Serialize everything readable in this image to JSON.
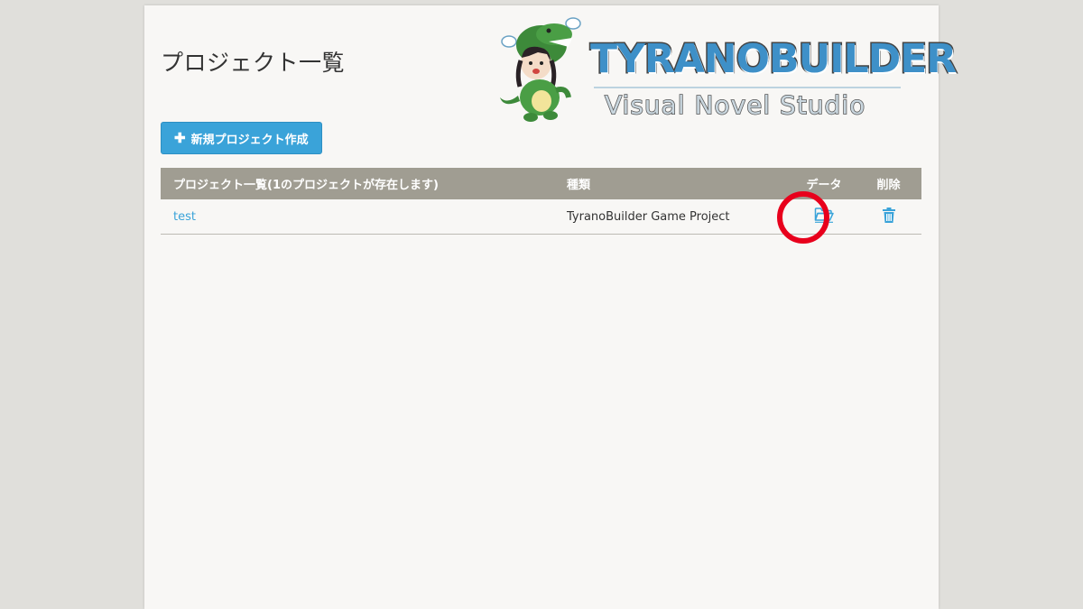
{
  "page": {
    "title": "プロジェクト一覧"
  },
  "logo": {
    "wordmark": "TYRANOBUILDER",
    "tagline": "Visual Novel Studio"
  },
  "toolbar": {
    "new_project_label": "新規プロジェクト作成",
    "new_project_icon": "plus-icon"
  },
  "table": {
    "headers": {
      "name": "プロジェクト一覧(1のプロジェクトが存在します)",
      "type": "種類",
      "data": "データ",
      "delete": "削除"
    },
    "rows": [
      {
        "name": "test",
        "type": "TyranoBuilder Game Project",
        "data_icon": "folder-open-icon",
        "delete_icon": "trash-icon"
      }
    ]
  },
  "colors": {
    "accent": "#3aa3d9",
    "header_bg": "#a09d92",
    "highlight": "#e8001c"
  }
}
